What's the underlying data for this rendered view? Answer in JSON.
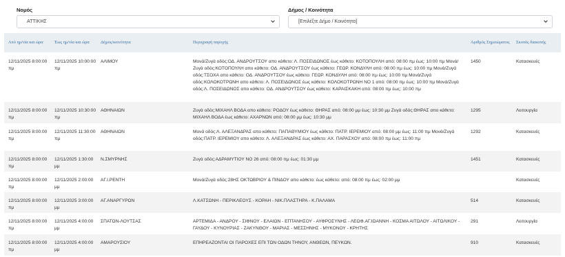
{
  "filters": {
    "nomos_label": "Νομός",
    "nomos_value": "ΑΤΤΙΚΗΣ",
    "dimos_label": "Δήμος / Κοινότητα",
    "dimos_value": "[Επιλέξτε Δήμο / Κοινότητα]"
  },
  "table": {
    "headers": [
      "Από ημ/νία και ώρα",
      "Έως ημ/νία και ώρα",
      "Δήμος/κοινότητα",
      "Περιγραφή παροχής",
      "Αριθμός Σημειώματος",
      "Σκοπός διακοπής"
    ],
    "rows": [
      [
        "12/11/2025 8:00:00 πμ",
        "12/11/2025 10:00:00 πμ",
        "ΑΛΙΜΟΥ",
        "Μονά/Ζυγά οδός:ΟΔ. ΑΝΔΡΟΥΤΣΟΥ απο κάθετο: Λ. ΠΟΣΕΙΔΩΝΟΣ έως κάθετο: ΚΟΤΟΠΟΥΛΗ από: 08:00 πμ έως: 10:00 πμ Μονά/Ζυγά οδός:ΚΟΤΟΠΟΥΛΗ απο κάθετο: ΟΔ. ΑΝΔΡΟΥΤΣΟΥ έως κάθετο: ΓΕΩΡ. ΚΟΝΔΥΛΗ από: 08:00 πμ έως: 10:00 πμ Μονά/Ζυγά οδός:ΤΣΟΧΑ απο κάθετο: ΟΔ. ΑΝΔΡΟΥΤΣΟΥ έως κάθετο: ΓΕΩΡ. ΚΟΝΔΥΛΗ από: 08:00 πμ έως: 10:00 πμ Μονά/Ζυγά οδός:ΚΟΛΟΚΟΤΡΩΝΗ απο κάθετο: Λ. ΠΟΣΕΙΔΩΝΟΣ έως κάθετο: ΚΟΛΟΚΟΤΡΩΝΗ ΝΟ 1 από: 08:00 πμ έως: 10:00 πμ Μονά/Ζυγά οδός:Λ. ΠΟΣΕΙΔΩΝΟΣ απο κάθετο: ΟΔ. ΑΝΔΡΟΥΤΣΟΥ έως κάθετο: ΚΑΡΑΙΣΚΑΚΗ από: 08:00 πμ έως: 10:00 πμ",
        "1450",
        "Κατασκευές"
      ],
      [
        "12/11/2025 8:00:00 πμ",
        "12/11/2025 10:30:00 πμ",
        "ΑΘΗΝΑΙΩΝ",
        "Ζυγά οδός:ΜΙΧΑΗΛ ΒΟΔΑ απο κάθετο: ΡΟΔΟΥ έως κάθετο: ΘΗΡΑΣ από: 08:00 μμ έως: 10:30 μμ Ζυγά οδός:ΘΗΡΑΣ απο κάθετο: ΜΙΧΑΗΛ ΒΟΔΑ έως κάθετο: ΑΧΑΡΝΩΝ από: 08:00 μμ έως: 10:30 μμ",
        "1295",
        "Λειτουργία"
      ],
      [
        "12/11/2025 8:00:00 πμ",
        "12/11/2025 11:30:00 πμ",
        "ΑΘΗΝΑΙΩΝ",
        "Μονά οδός:Λ. ΑΛΕΞΑΝΔΡΑΣ απο κάθετο: ΠΑΠΑΘΥΜΙΟΥ έως κάθετο: ΠΑΤΡ. ΙΕΡΕΜΙΟΥ από: 08:00 μμ έως: 11:00 πμ Μονά/Ζυγά οδός:ΠΑΤΡ. ΙΕΡΕΜΙΟΥ απο κάθετο: Λ. ΑΛΕΞΑΝΔΡΑΣ έως κάθετο: ΑΧ. ΠΑΡΑΣΧΟΥ από: 08:00 πμ έως: 11:00 πμ",
        "1292",
        "Κατασκευές"
      ],
      [
        "12/11/2025 8:00:00 πμ",
        "12/11/2025 1:30:00 μμ",
        "Ν.ΣΜΥΡΝΗΣ",
        "Ζυγά οδός:ΑΔΡΑΜΥΤΙΟΥ ΝΟ 26 από: 08:00 πμ έως: 01:30 μμ",
        "1451",
        "Κατασκευές"
      ],
      [
        "12/11/2025 8:00:00 πμ",
        "12/11/2025 2:00:00 μμ",
        "ΑΓ.Ι.ΡΕΝΤΗ",
        "Μονά/Ζυγά οδός:28ΗΣ ΟΚΤΩΒΡΙΟΥ & ΠΙΝΔΟΥ απο κάθετο: έως κάθετο: από: 08:00 πμ έως: 02:00 μμ",
        "",
        "Κατασκευές"
      ],
      [
        "12/11/2025 8:00:00 πμ",
        "12/11/2025 3:00:00 μμ",
        "ΑΓ.ΑΝΑΡΓΥΡΩΝ",
        "Λ.ΚΑΤΣΩΝΗ - ΠΕΡΙΚΛΕΟΥΣ - ΚΟΡΑΗ - ΝΙΚ.ΠΛΑΣΤΗΡΑ - Κ.ΠΑΛΑΜΑ",
        "514",
        "Κατασκευές"
      ],
      [
        "12/11/2025 8:00:00 πμ",
        "12/11/2025 4:00:00 μμ",
        "ΣΠΑΤΩΝ-ΛΟΥΤΣΑΣ",
        "ΑΡΤΕΜΙΔΑ - ΑΝΔΡΟΥ - ΣΙΦΝΟΥ - ΕΛΑΙΩΝ - ΕΠΤΑΝΗΣΟΥ - ΑΥΦΡΟΣΥΝΗΣ - ΛΕΩΦ.ΑΓ.ΙΩΑΝΝΗ - ΚΟΣΜΑ ΑΙΤΩΛΟΥ - ΑΙΤΩΛΙΚΟΥ - ΓΑΥΔΟΥ - ΚΥΝΟΥΡΙΑΣ - ΖΑΚΥΝΘΟΥ - ΜΑΡΙΑΣ - ΜΕΣΣΗΝΗΣ - ΜΥΚΟΝΟΥ - ΚΡΗΤΗΣ",
        "291",
        "Λειτουργία"
      ],
      [
        "12/11/2025 8:00:00 πμ",
        "12/11/2025 4:00:00 μμ",
        "ΑΜΑΡΟΥΣΙΟΥ",
        "ΕΠΗΡΕΑΖΟΝΤΑΙ ΟΙ ΠΑΡΟΧΕΣ ΕΠΙ ΤΩΝ ΟΔΩΝ ΤΗΝΟΥ, ΑΝΘΕΩΝ, ΠΕΥΚΩΝ.",
        "910",
        "Κατασκευές"
      ]
    ]
  },
  "colors": {
    "header_bg": "#e9eef2",
    "header_text": "#3a6ea5",
    "row_alt": "#f3f3f3"
  },
  "icons": {
    "select_arrow": "chevron-down-icon"
  }
}
